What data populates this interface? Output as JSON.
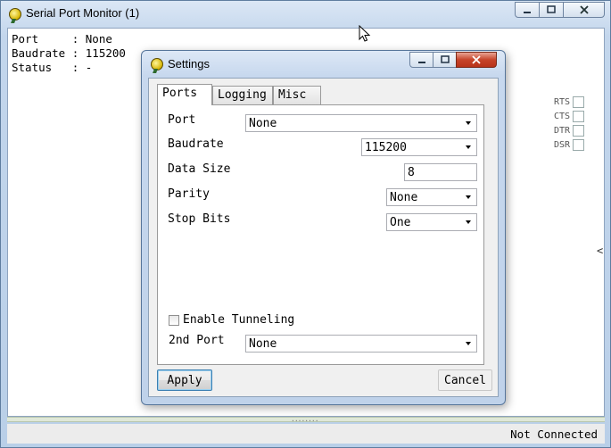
{
  "main_window": {
    "title": "Serial Port Monitor (1)",
    "info_lines": [
      "Port     : None",
      "Baudrate : 115200",
      "Status   : -"
    ],
    "signals": [
      "RTS",
      "CTS",
      "DTR",
      "DSR"
    ],
    "side_arrow": "<",
    "status": "Not Connected"
  },
  "dialog": {
    "title": "Settings",
    "tabs": [
      "Ports",
      "Logging",
      "Misc"
    ],
    "active_tab": "Ports",
    "fields": {
      "port": {
        "label": "Port",
        "value": "None"
      },
      "baudrate": {
        "label": "Baudrate",
        "value": "115200"
      },
      "data_size": {
        "label": "Data Size",
        "value": "8"
      },
      "parity": {
        "label": "Parity",
        "value": "None"
      },
      "stop_bits": {
        "label": "Stop Bits",
        "value": "One"
      }
    },
    "enable_tunneling": {
      "label": "Enable Tunneling",
      "checked": false
    },
    "second_port": {
      "label": "2nd Port",
      "value": "None"
    },
    "apply_label": "Apply",
    "cancel_label": "Cancel"
  },
  "icons": {
    "app": "app-icon",
    "minimize": "minimize-icon",
    "maximize": "maximize-icon",
    "close": "close-icon",
    "dropdown": "chevron-down-icon"
  }
}
